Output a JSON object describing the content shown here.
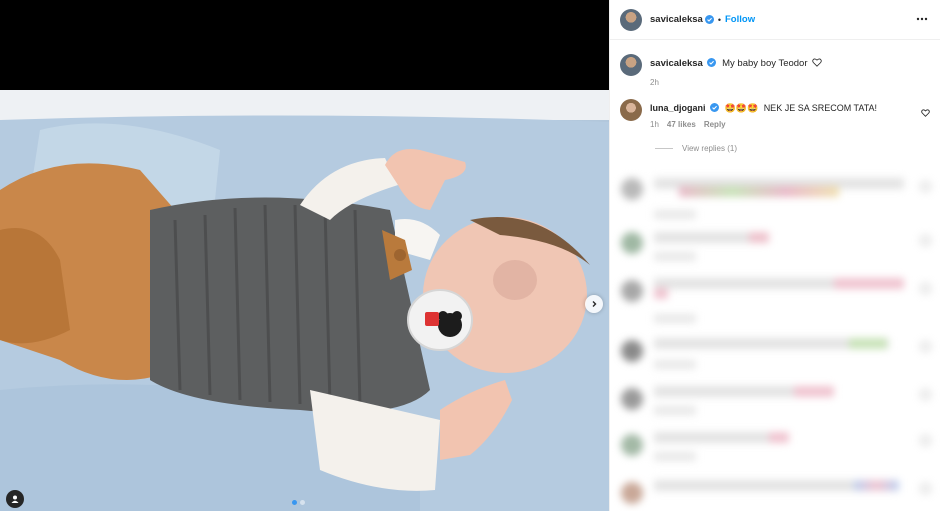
{
  "post": {
    "username": "savicaleksa",
    "follow_label": "Follow",
    "separator": "•",
    "caption": "My baby boy Teodor",
    "caption_time": "2h"
  },
  "icons": {
    "more": "more-options-icon",
    "verified": "verified-badge-icon",
    "heart": "heart-icon",
    "next": "chevron-right-icon",
    "tag": "user-tag-icon"
  },
  "comments": [
    {
      "username": "luna_djogani",
      "emojis": "🤩🤩🤩",
      "text": "NEK JE SA SRECOM TATA!",
      "time": "1h",
      "likes": "47 likes",
      "reply_label": "Reply",
      "view_replies": "View replies (1)"
    }
  ],
  "colors": {
    "accent": "#0095f6",
    "verified": "#3897f0",
    "secondary_text": "#8e8e8e"
  }
}
